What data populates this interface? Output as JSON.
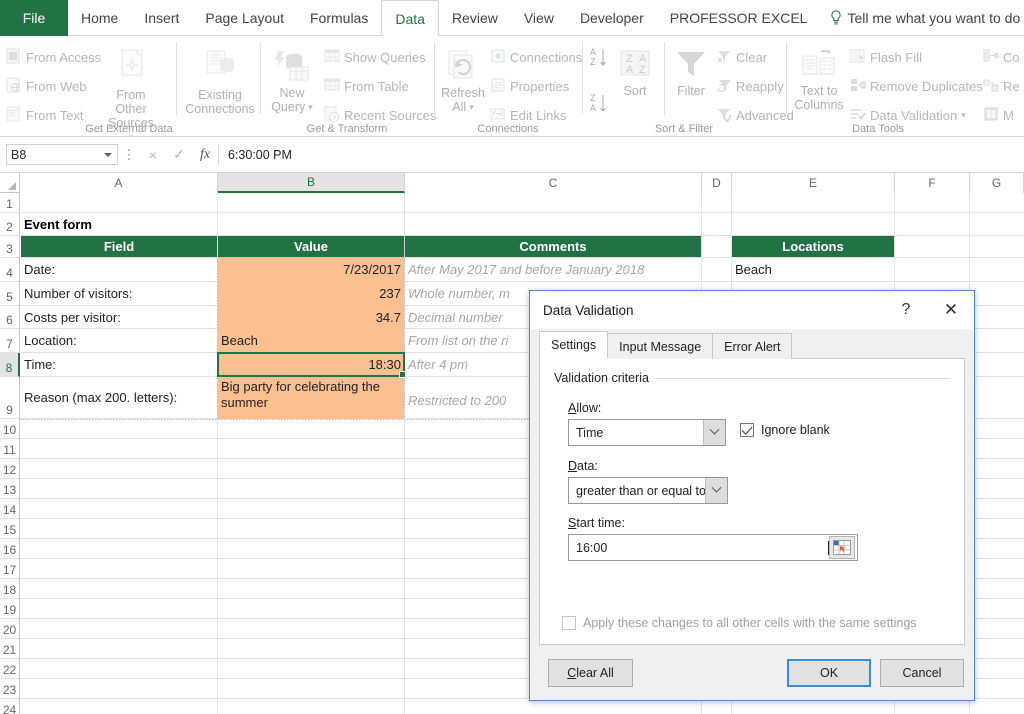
{
  "ribbon": {
    "tabs": [
      {
        "label": "File",
        "active": false
      },
      {
        "label": "Home",
        "active": false
      },
      {
        "label": "Insert",
        "active": false
      },
      {
        "label": "Page Layout",
        "active": false
      },
      {
        "label": "Formulas",
        "active": false
      },
      {
        "label": "Data",
        "active": true
      },
      {
        "label": "Review",
        "active": false
      },
      {
        "label": "View",
        "active": false
      },
      {
        "label": "Developer",
        "active": false
      },
      {
        "label": "PROFESSOR EXCEL",
        "active": false
      }
    ],
    "tellme": "Tell me what you want to do",
    "groups": [
      {
        "name": "Get External Data",
        "items": [
          "From Access",
          "From Web",
          "From Text",
          "From Other Sources",
          "Existing Connections"
        ]
      },
      {
        "name": "Get & Transform",
        "items": [
          "New Query",
          "Show Queries",
          "From Table",
          "Recent Sources"
        ]
      },
      {
        "name": "Connections",
        "items": [
          "Refresh All",
          "Connections",
          "Properties",
          "Edit Links"
        ]
      },
      {
        "name": "Sort & Filter",
        "items": [
          "Sort",
          "Filter",
          "Clear",
          "Reapply",
          "Advanced"
        ]
      },
      {
        "name": "Data Tools",
        "items": [
          "Text to Columns",
          "Flash Fill",
          "Remove Duplicates",
          "Data Validation",
          "Consolidate",
          "Relationships",
          "Manage Data Model"
        ]
      }
    ],
    "labels": {
      "from_access": "From Access",
      "from_web": "From Web",
      "from_text": "From Text",
      "from_other_sources_1": "From Other",
      "from_other_sources_2": "Sources",
      "existing_1": "Existing",
      "existing_2": "Connections",
      "new_query_1": "New",
      "new_query_2": "Query",
      "show_queries": "Show Queries",
      "from_table": "From Table",
      "recent_sources": "Recent Sources",
      "refresh_1": "Refresh",
      "refresh_2": "All",
      "connections": "Connections",
      "properties": "Properties",
      "edit_links": "Edit Links",
      "sort": "Sort",
      "filter": "Filter",
      "clear": "Clear",
      "reapply": "Reapply",
      "advanced": "Advanced",
      "text_to_columns_1": "Text to",
      "text_to_columns_2": "Columns",
      "flash_fill": "Flash Fill",
      "remove_duplicates": "Remove Duplicates",
      "data_validation": "Data Validation",
      "consolidate_trunc": "Co",
      "relationships_trunc": "Re",
      "manage_trunc": "M",
      "group_get_external": "Get External Data",
      "group_get_transform": "Get & Transform",
      "group_connections": "Connections",
      "group_sort_filter": "Sort & Filter",
      "group_data_tools": "Data Tools"
    }
  },
  "formula_bar": {
    "name_box": "B8",
    "value": "6:30:00 PM",
    "cancel_icon": "×",
    "enter_icon": "✓",
    "fx": "fx"
  },
  "grid": {
    "columns": [
      "A",
      "B",
      "C",
      "D",
      "E",
      "F",
      "G"
    ],
    "selected_column": "B",
    "rows": [
      "1",
      "2",
      "3",
      "4",
      "5",
      "6",
      "7",
      "8",
      "9",
      "10",
      "11",
      "12",
      "13",
      "14",
      "15",
      "16",
      "17",
      "18",
      "19",
      "20",
      "21",
      "22",
      "23",
      "24"
    ],
    "selected_row": "8",
    "cells": {
      "a2": "Event form",
      "a3": "Field",
      "b3": "Value",
      "c3": "Comments",
      "e3": "Locations",
      "a4": "Date:",
      "b4": "7/23/2017",
      "c4": "After May 2017 and before January 2018",
      "e4": "Beach",
      "a5": "Number of visitors:",
      "b5": "237",
      "c5": "Whole number, m",
      "a6": "Costs per visitor:",
      "b6": "34.7",
      "c6": "Decimal number",
      "a7": "Location:",
      "b7": "Beach",
      "c7": "From list on the ri",
      "a8": "Time:",
      "b8": "18:30",
      "c8": "After 4 pm",
      "a9": "Reason (max 200. letters):",
      "b9": "Big party for celebrating the summer",
      "c9": "Restricted to 200 "
    }
  },
  "dialog": {
    "title": "Data Validation",
    "help_icon": "?",
    "close_icon": "✕",
    "tabs": [
      {
        "label": "Settings",
        "active": true
      },
      {
        "label": "Input Message",
        "active": false
      },
      {
        "label": "Error Alert",
        "active": false
      }
    ],
    "group_label": "Validation criteria",
    "allow_label": "Allow:",
    "allow_value": "Time",
    "ignore_blank_label": "Ignore blank",
    "ignore_blank_checked": true,
    "data_label": "Data:",
    "data_value": "greater than or equal to",
    "start_time_label": "Start time:",
    "start_time_value": "16:00",
    "apply_all_label": "Apply these changes to all other cells with the same settings",
    "apply_all_checked": false,
    "buttons": {
      "clear_all": "Clear All",
      "ok": "OK",
      "cancel": "Cancel"
    }
  },
  "colors": {
    "excel_green": "#217346",
    "header_green": "#217346",
    "fill_orange": "#fac090",
    "dialog_border_blue": "#4a8fd4",
    "primary_button_blue": "#3a8fd4"
  }
}
